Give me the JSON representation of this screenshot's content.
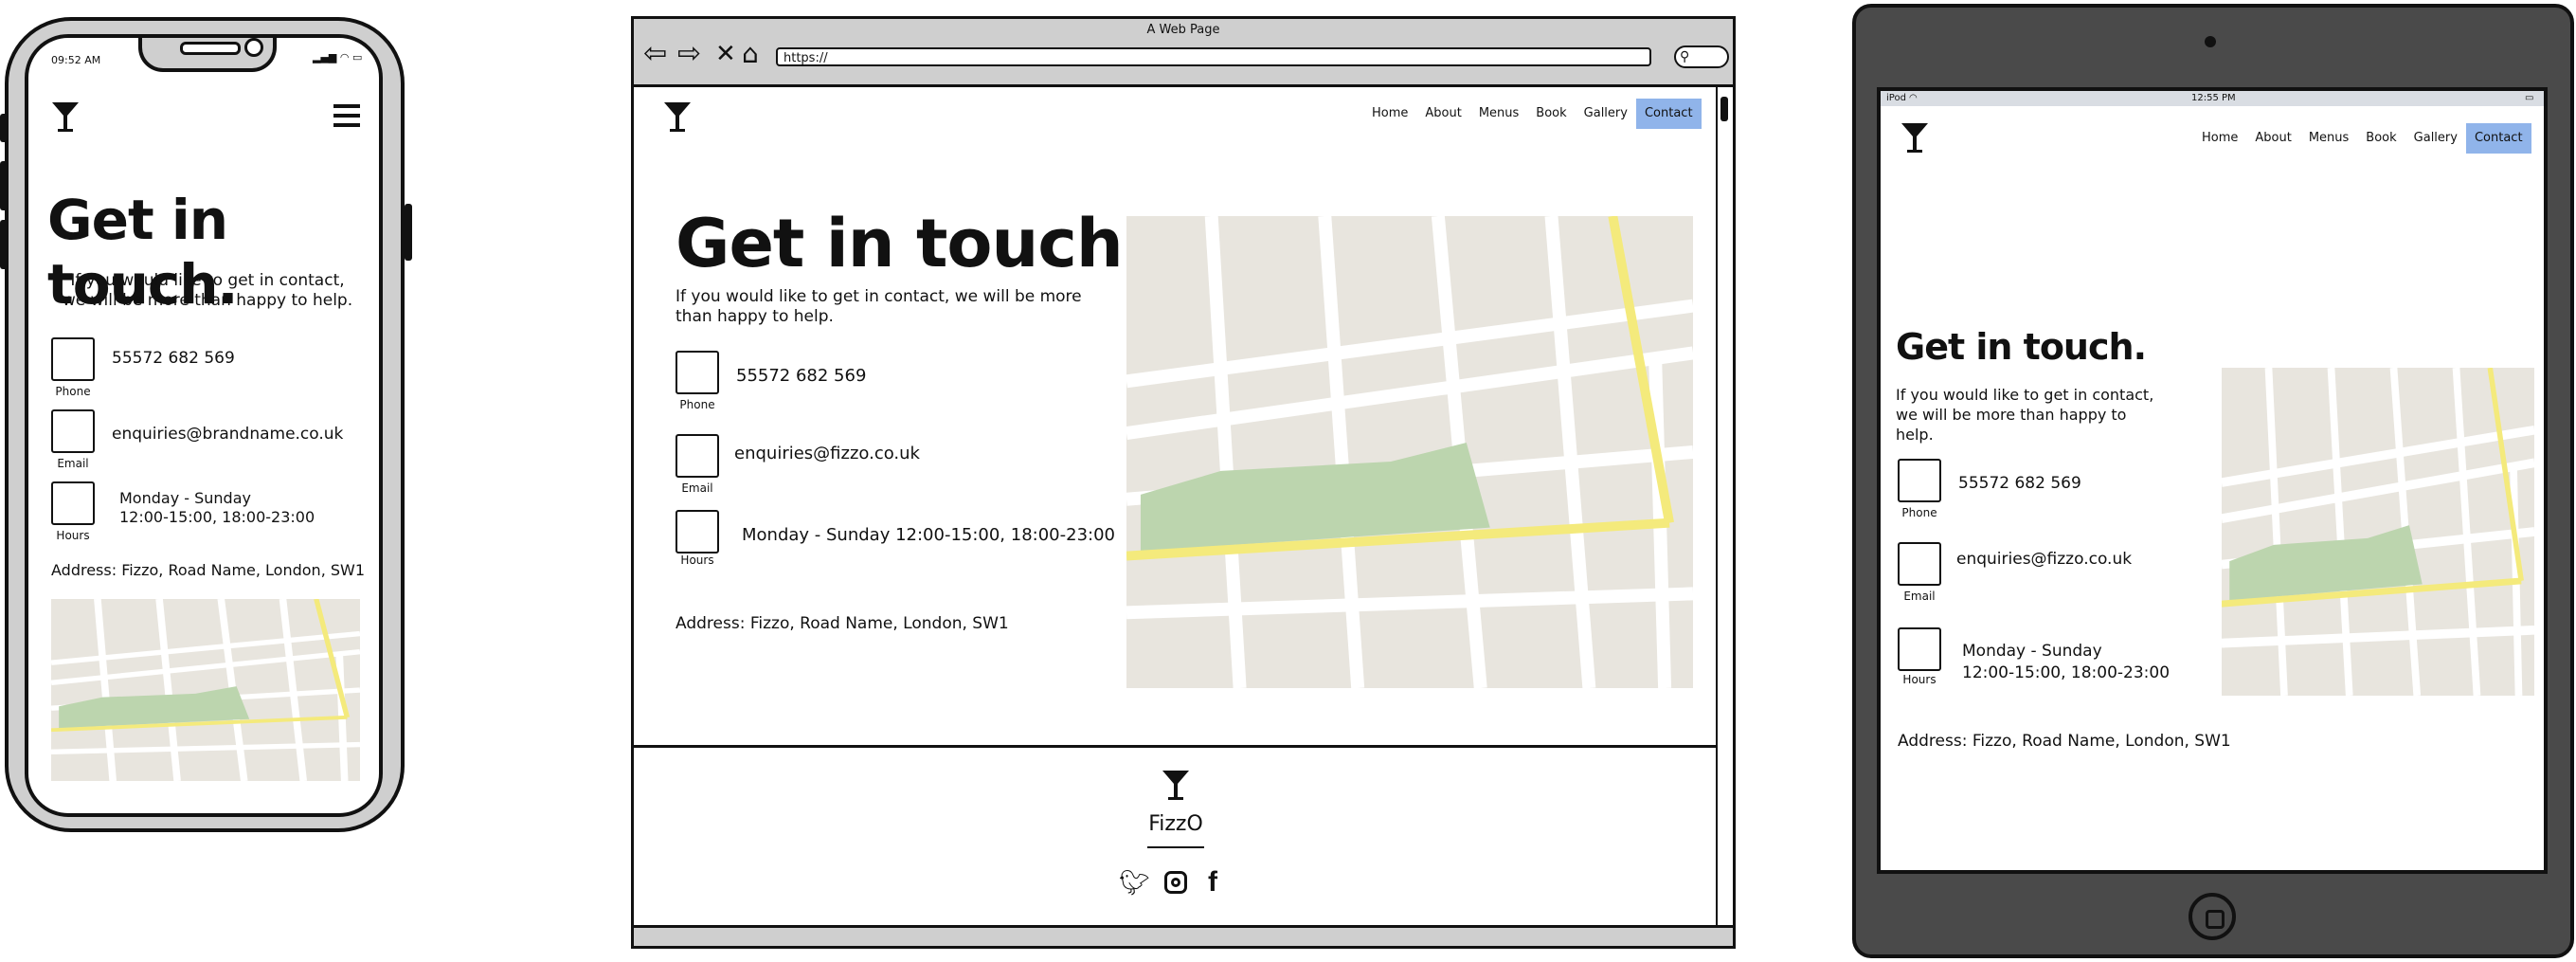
{
  "brand": "FizzO",
  "colors": {
    "accent": "#90b4ea",
    "map_bg": "#e8e5de",
    "map_park": "#bcd5ae",
    "map_road": "#f4ea7c",
    "device_frame": "#4a4a4a"
  },
  "phone": {
    "time": "09:52 AM",
    "heading": "Get in touch.",
    "intro": "If you would like to get in contact, we will be more than happy to help.",
    "phone_value": "55572 682 569",
    "phone_caption": "Phone",
    "email_value": "enquiries@brandname.co.uk",
    "email_caption": "Email",
    "hours_line1": "Monday - Sunday",
    "hours_line2": "12:00-15:00, 18:00-23:00",
    "hours_caption": "Hours",
    "address": "Address: Fizzo, Road Name, London, SW1"
  },
  "browser": {
    "window_title": "A Web Page",
    "url": "https://",
    "nav": [
      "Home",
      "About",
      "Menus",
      "Book",
      "Gallery",
      "Contact"
    ],
    "heading": "Get in touch.",
    "intro": "If you would like to get in contact, we will be more than happy to help.",
    "phone_value": "55572 682 569",
    "phone_caption": "Phone",
    "email_value": "enquiries@fizzo.co.uk",
    "email_caption": "Email",
    "hours_value": "Monday - Sunday 12:00-15:00, 18:00-23:00",
    "hours_caption": "Hours",
    "address": "Address: Fizzo, Road Name, London, SW1",
    "footer_brand": "FizzO",
    "social_icons": [
      "twitter-icon",
      "instagram-icon",
      "facebook-icon"
    ]
  },
  "tablet": {
    "carrier": "iPod",
    "time": "12:55 PM",
    "nav": [
      "Home",
      "About",
      "Menus",
      "Book",
      "Gallery",
      "Contact"
    ],
    "heading": "Get in touch.",
    "intro": "If you would like to get in contact, we will be more than happy to help.",
    "phone_value": "55572 682 569",
    "phone_caption": "Phone",
    "email_value": "enquiries@fizzo.co.uk",
    "email_caption": "Email",
    "hours_line1": "Monday - Sunday",
    "hours_line2": "12:00-15:00, 18:00-23:00",
    "hours_caption": "Hours",
    "address": "Address: Fizzo, Road Name, London, SW1"
  }
}
